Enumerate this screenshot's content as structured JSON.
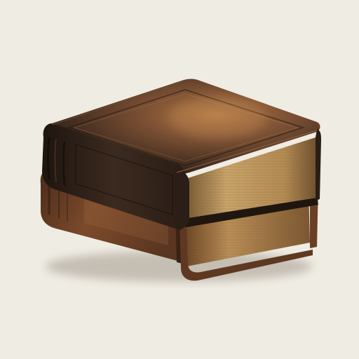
{
  "icon": {
    "name": "book-stack-icon",
    "colors": {
      "background": "#efece3",
      "leather_dark": "#2a1d15",
      "leather_mid": "#5a3a26",
      "leather_light": "#9a5f35",
      "page_edge": "#b8945c",
      "page_edge_light": "#d9bc85"
    }
  }
}
